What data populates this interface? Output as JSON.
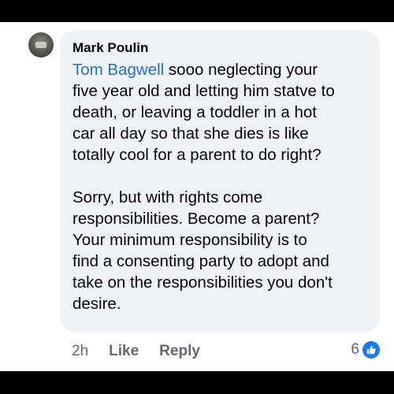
{
  "comment": {
    "author": "Mark Poulin",
    "mention": "Tom Bagwell",
    "paragraph1_rest": " sooo neglecting your\nfive year old and letting him statve to\ndeath, or leaving a toddler in a hot\ncar all day so that she dies is like\ntotally cool for a parent to do right?",
    "paragraph2": "Sorry, but with rights come\nresponsibilities. Become a parent?\nYour minimum responsibility is to\nfind a consenting party to adopt and\ntake on the responsibilities you don't\ndesire."
  },
  "actions": {
    "time": "2h",
    "like": "Like",
    "reply": "Reply"
  },
  "reactions": {
    "count": "6",
    "icon": "thumbs-up-icon",
    "color": "#1877f2"
  }
}
